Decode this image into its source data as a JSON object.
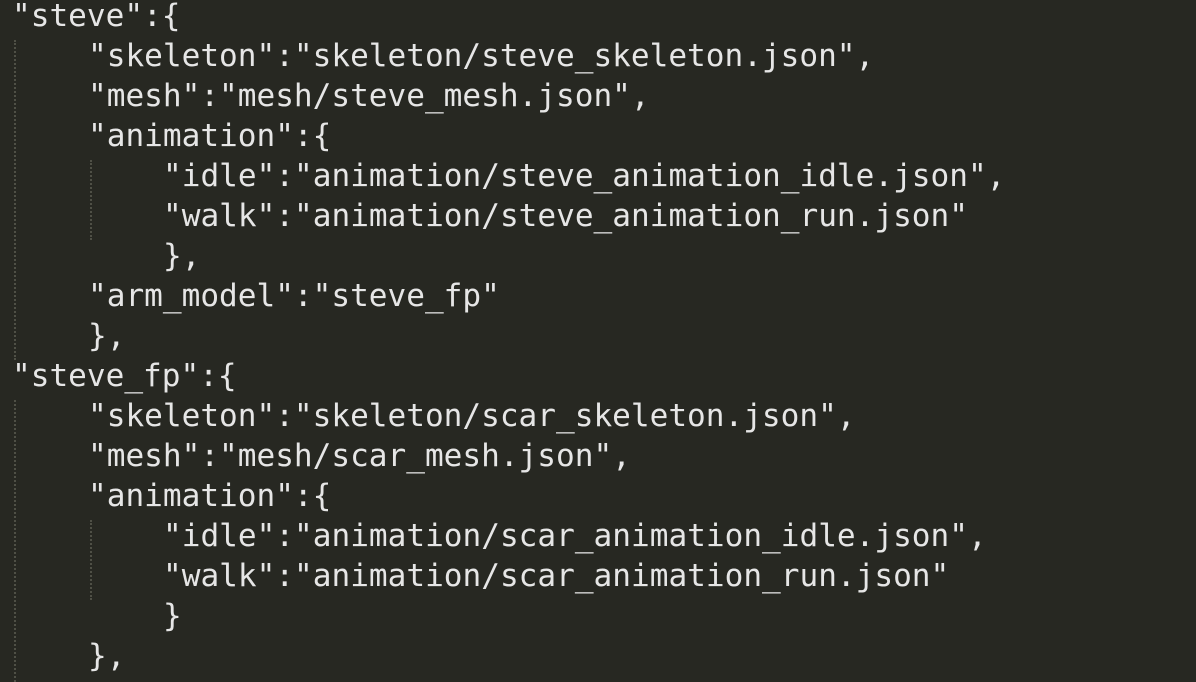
{
  "editor": {
    "lines": [
      "\"steve\":{",
      "\"skeleton\":\"skeleton/steve_skeleton.json\",",
      "\"mesh\":\"mesh/steve_mesh.json\",",
      "\"animation\":{",
      "\"idle\":\"animation/steve_animation_idle.json\",",
      "\"walk\":\"animation/steve_animation_run.json\"",
      "},",
      "\"arm_model\":\"steve_fp\"",
      "},",
      "\"steve_fp\":{",
      "\"skeleton\":\"skeleton/scar_skeleton.json\",",
      "\"mesh\":\"mesh/scar_mesh.json\",",
      "\"animation\":{",
      "\"idle\":\"animation/scar_animation_idle.json\",",
      "\"walk\":\"animation/scar_animation_run.json\"",
      "}",
      "},"
    ]
  },
  "colors": {
    "background": "#272822",
    "text": "#e6e6e6",
    "indent_guide": "#4f5046"
  }
}
